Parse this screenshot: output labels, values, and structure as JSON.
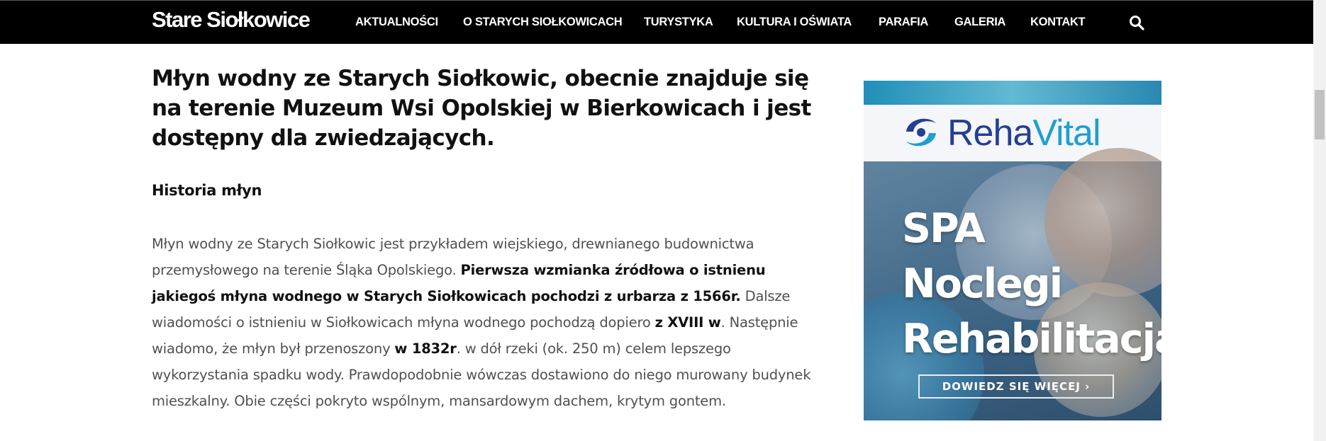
{
  "header": {
    "logo": "Stare Siołkowice",
    "nav": [
      {
        "label": "AKTUALNOŚCI"
      },
      {
        "label": "O STARYCH SIOŁKOWICACH"
      },
      {
        "label": "TURYSTYKA"
      },
      {
        "label": "KULTURA I OŚWIATA"
      },
      {
        "label": "PARAFIA"
      },
      {
        "label": "GALERIA"
      },
      {
        "label": "KONTAKT"
      }
    ],
    "search_icon": "search-icon"
  },
  "article": {
    "title": "Młyn wodny ze Starych Siołkowic, obecnie znajduje się na terenie Muzeum Wsi Opolskiej w Bierkowicach i jest dostępny dla zwiedzających.",
    "subtitle": "Historia młyn",
    "para": {
      "t1": "Młyn wodny ze Starych Siołkowic jest przykładem wiejskiego, drewnianego budownictwa przemysłowego na terenie Śląka Opolskiego. ",
      "b1": "Pierwsza wzmianka źródłowa o istnienu jakiegoś młyna wodnego w Starych Siołkowicach pochodzi z urbarza z 1566r.",
      "t2": " Dalsze wiadomości o istnieniu w Siołkowicach młyna wodnego pochodzą dopiero ",
      "b2": "z XVIII w",
      "t3": ". Następnie wiadomo, że młyn był przenoszony ",
      "b3": "w 1832r",
      "t4": ". w dół rzeki (ok. 250 m) celem lepszego wykorzystania spadku wody. Prawdopodobnie wówczas dostawiono do niego murowany budynek mieszkalny. Obie części pokryto wspólnym, mansardowym dachem, krytym gontem."
    }
  },
  "ad": {
    "brand_a": "Reha",
    "brand_b": "Vital",
    "line1": "SPA",
    "line2": "Noclegi",
    "line3": "Rehabilitacja",
    "cta": "DOWIEDZ SIĘ WIĘCEJ ›"
  },
  "colors": {
    "nav_bg": "#000000",
    "brand_navy": "#263e94",
    "brand_blue": "#1f9fd2"
  }
}
